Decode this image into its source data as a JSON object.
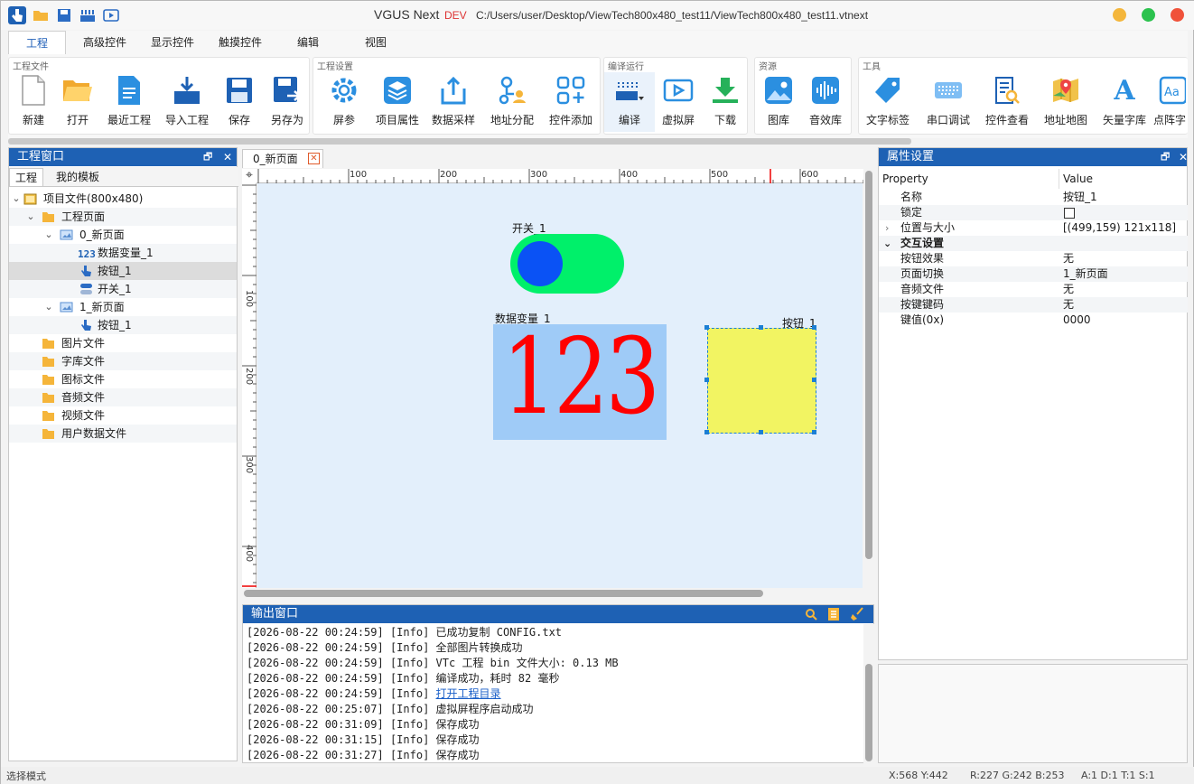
{
  "app": {
    "title": "VGUS Next",
    "edition": "DEV",
    "path": "C:/Users/user/Desktop/ViewTech800x480_test11/ViewTech800x480_test11.vtnext",
    "colors": {
      "accent": "#1e61b4",
      "min": "#f4b63c",
      "max": "#2cc24e",
      "close": "#f0523a"
    }
  },
  "menu": {
    "tabs": [
      "工程",
      "高级控件",
      "显示控件",
      "触摸控件",
      "编辑",
      "视图"
    ],
    "active": "工程"
  },
  "ribbon": {
    "groups": [
      {
        "label": "工程文件",
        "buttons": [
          "新建",
          "打开",
          "最近工程",
          "导入工程",
          "保存",
          "另存为"
        ]
      },
      {
        "label": "工程设置",
        "buttons": [
          "屏参",
          "项目属性",
          "数据采样",
          "地址分配",
          "控件添加"
        ]
      },
      {
        "label": "编译运行",
        "buttons": [
          "编译",
          "虚拟屏",
          "下载"
        ]
      },
      {
        "label": "资源",
        "buttons": [
          "图库",
          "音效库"
        ]
      },
      {
        "label": "工具",
        "buttons": [
          "文字标签",
          "串口调试",
          "控件查看",
          "地址地图",
          "矢量字库",
          "点阵字"
        ]
      }
    ]
  },
  "project_panel": {
    "title": "工程窗口",
    "tabs": [
      "工程",
      "我的模板"
    ],
    "tree": [
      {
        "label": "项目文件(800x480)",
        "icon": "project-icon"
      },
      {
        "label": "工程页面",
        "icon": "folder-icon"
      },
      {
        "label": "0_新页面",
        "icon": "page-icon"
      },
      {
        "label": "数据变量_1",
        "icon": "number-var-icon"
      },
      {
        "label": "按钮_1",
        "icon": "hand-pointer-icon"
      },
      {
        "label": "开关_1",
        "icon": "toggle-icon"
      },
      {
        "label": "1_新页面",
        "icon": "page-icon"
      },
      {
        "label": "按钮_1",
        "icon": "hand-pointer-icon"
      },
      {
        "label": "图片文件",
        "icon": "folder-icon"
      },
      {
        "label": "字库文件",
        "icon": "folder-icon"
      },
      {
        "label": "图标文件",
        "icon": "folder-icon"
      },
      {
        "label": "音频文件",
        "icon": "folder-icon"
      },
      {
        "label": "视频文件",
        "icon": "folder-icon"
      },
      {
        "label": "用户数据文件",
        "icon": "folder-icon"
      }
    ]
  },
  "document": {
    "tab": "0_新页面",
    "ruler_top": [
      "100",
      "200",
      "300",
      "400",
      "500",
      "600"
    ],
    "ruler_left": [
      "100",
      "200",
      "300",
      "400"
    ],
    "widgets": {
      "switch": {
        "label": "开关_1",
        "on_color": "#00f06a",
        "knob_color": "#0a52f5"
      },
      "number": {
        "label": "数据变量_1",
        "value": "123",
        "bg": "#9fcbf7",
        "fg": "#ff0000"
      },
      "button": {
        "label": "按钮_1",
        "bg": "#f2f462"
      }
    }
  },
  "output": {
    "title": "输出窗口",
    "logs": [
      {
        "ts": "[2026-08-22 00:24:59]",
        "level": "[Info]",
        "msg": "已成功复制 CONFIG.txt"
      },
      {
        "ts": "[2026-08-22 00:24:59]",
        "level": "[Info]",
        "msg": "全部图片转换成功"
      },
      {
        "ts": "[2026-08-22 00:24:59]",
        "level": "[Info]",
        "msg": "VTc 工程 bin 文件大小: 0.13 MB"
      },
      {
        "ts": "[2026-08-22 00:24:59]",
        "level": "[Info]",
        "msg": "编译成功，耗时 82 毫秒"
      },
      {
        "ts": "[2026-08-22 00:24:59]",
        "level": "[Info]",
        "msg": "打开工程目录",
        "link": true
      },
      {
        "ts": "[2026-08-22 00:25:07]",
        "level": "[Info]",
        "msg": "虚拟屏程序启动成功"
      },
      {
        "ts": "[2026-08-22 00:31:09]",
        "level": "[Info]",
        "msg": "保存成功"
      },
      {
        "ts": "[2026-08-22 00:31:15]",
        "level": "[Info]",
        "msg": "保存成功"
      },
      {
        "ts": "[2026-08-22 00:31:27]",
        "level": "[Info]",
        "msg": "保存成功"
      }
    ]
  },
  "properties": {
    "title": "属性设置",
    "headers": [
      "Property",
      "Value"
    ],
    "rows": [
      {
        "key": "名称",
        "value": "按钮_1"
      },
      {
        "key": "锁定",
        "value": "",
        "checkbox": true
      },
      {
        "key": "位置与大小",
        "value": "[(499,159) 121x118]",
        "expander": "collapsed"
      },
      {
        "key": "交互设置",
        "value": "",
        "expander": "expanded",
        "bold": true
      },
      {
        "key": "按钮效果",
        "value": "无"
      },
      {
        "key": "页面切换",
        "value": "1_新页面"
      },
      {
        "key": "音频文件",
        "value": "无"
      },
      {
        "key": "按键键码",
        "value": "无"
      },
      {
        "key": "键值(0x)",
        "value": "0000"
      }
    ]
  },
  "status": {
    "mode": "选择模式",
    "coords": "X:568  Y:442",
    "rgb": "R:227 G:242 B:253",
    "flags": "A:1  D:1  T:1  S:1"
  }
}
